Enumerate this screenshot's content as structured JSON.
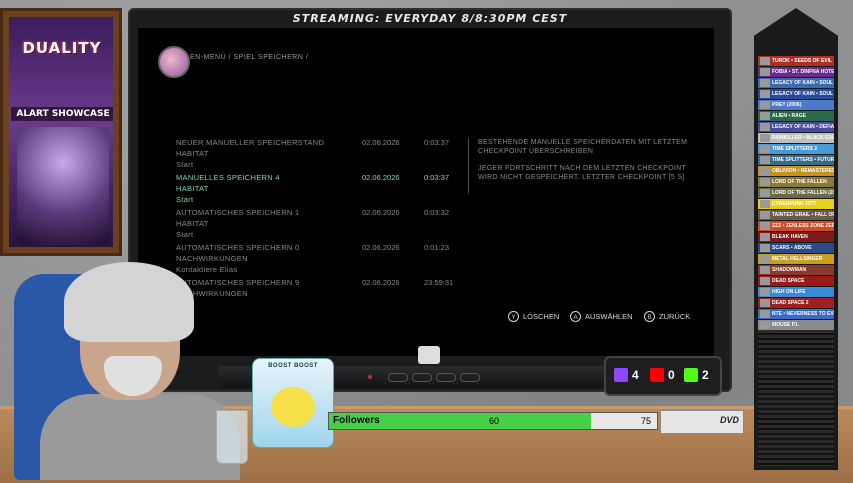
{
  "stream": {
    "title": "STREAMING: EVERYDAY 8/8:30PM CEST"
  },
  "poster": {
    "logo": "DUALITY",
    "subtitle": "ALART SHOWCASE"
  },
  "breadcrumb": "EN-MENÜ / SPIEL SPEICHERN /",
  "saves": [
    {
      "line1": "NEUER MANUELLER SPEICHERSTAND",
      "line2": "HABITAT",
      "line3": "Start",
      "date": "02.06.2026",
      "time": "0:03:37",
      "selected": false
    },
    {
      "line1": "MANUELLES SPEICHERN 4",
      "line2": "HABITAT",
      "line3": "Start",
      "date": "02.06.2026",
      "time": "0:03:37",
      "selected": true
    },
    {
      "line1": "AUTOMATISCHES SPEICHERN 1",
      "line2": "HABITAT",
      "line3": "Start",
      "date": "02.06.2026",
      "time": "0:03:32",
      "selected": false
    },
    {
      "line1": "AUTOMATISCHES SPEICHERN 0",
      "line2": "NACHWIRKUNGEN",
      "line3": "Kontaktiere Elias",
      "date": "02.06.2026",
      "time": "0:01:23",
      "selected": false
    },
    {
      "line1": "AUTOMATISCHES SPEICHERN 9",
      "line2": "NACHWIRKUNGEN",
      "line3": "",
      "date": "02.06.2026",
      "time": "23:59:31",
      "selected": false
    }
  ],
  "info": {
    "p1": "BESTEHENDE MANUELLE SPEICHERDATEN MIT LETZTEM CHECKPOINT ÜBERSCHREIBEN",
    "p2": "JEGER FORTSCHRITT NACH DEM LETZTEN CHECKPOINT WIRD NICHT GESPEICHERT. LETZTER CHECKPOINT [5 S]"
  },
  "controls": [
    {
      "glyph": "Y",
      "label": "LÖSCHEN"
    },
    {
      "glyph": "A",
      "label": "AUSWÄHLEN"
    },
    {
      "glyph": "B",
      "label": "ZURÜCK"
    }
  ],
  "social": {
    "twitch": "4",
    "youtube": "0",
    "kick": "2"
  },
  "followers": {
    "label": "Followers",
    "current": "60",
    "goal": "75",
    "progress": 0.8
  },
  "dvd": "DVD",
  "can": {
    "label": "BOOST BOOST"
  },
  "games": [
    {
      "name": "TUROK • SEEDS OF EVIL",
      "color": "#b03020"
    },
    {
      "name": "FOBIA • ST. DINFNA HOTEL",
      "color": "#6a2a8a"
    },
    {
      "name": "LEGACY OF KAIN • SOUL REAVER",
      "color": "#3a6ab0"
    },
    {
      "name": "LEGACY OF KAIN • SOUL REAVER 2",
      "color": "#2a4a9a"
    },
    {
      "name": "PREY (2006)",
      "color": "#4a7ac8"
    },
    {
      "name": "ALIEN • RAGE",
      "color": "#2a6a4a"
    },
    {
      "name": "LEGACY OF KAIN • DEFIANCE",
      "color": "#4a4aa0"
    },
    {
      "name": "PAINKILLER • BLACK EDITION",
      "color": "#c0c0c0"
    },
    {
      "name": "TIME SPLITTERS 2",
      "color": "#4a9ad8"
    },
    {
      "name": "TIME SPLITTERS • FUTURE PERFECT",
      "color": "#3a6a8a"
    },
    {
      "name": "OBLIVION • REMASTERED",
      "color": "#c89020"
    },
    {
      "name": "LORD OF THE FALLEN",
      "color": "#8a7a3a"
    },
    {
      "name": "LORD OF THE FALLEN (2023)",
      "color": "#6a6a4a"
    },
    {
      "name": "CYBERPUNK 2077",
      "color": "#e8d020"
    },
    {
      "name": "TAINTED GRAIL • FALL OF AVALON",
      "color": "#6a5a4a"
    },
    {
      "name": "ZZZ • ZENLESS ZONE ZERO",
      "color": "#d04a2a"
    },
    {
      "name": "BLEAK HAVEN",
      "color": "#7a1a1a"
    },
    {
      "name": "SCARS • ABOVE",
      "color": "#2a4a8a"
    },
    {
      "name": "METAL HELLSINGER",
      "color": "#c8a020"
    },
    {
      "name": "SHADOWMAN",
      "color": "#8a3a2a"
    },
    {
      "name": "DEAD SPACE",
      "color": "#9a1a1a"
    },
    {
      "name": "HIGH ON LIFE",
      "color": "#3a8ad8"
    },
    {
      "name": "DEAD SPACE 2",
      "color": "#a02020"
    },
    {
      "name": "NTE • NEVERNESS TO EVERNESS",
      "color": "#3a6ac8"
    },
    {
      "name": "MOUSE P.I.",
      "color": "#8a8a8a"
    }
  ]
}
